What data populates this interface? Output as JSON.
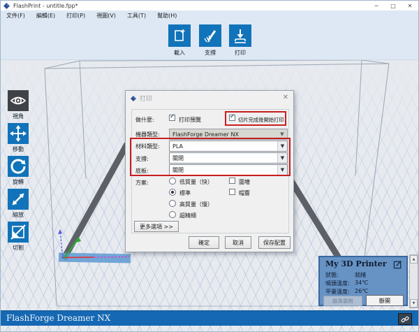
{
  "window": {
    "title": "FlashPrint - untitle.fpp*",
    "minimize": "─",
    "maximize": "□",
    "close": "✕"
  },
  "menu": {
    "items": [
      "文件(F)",
      "編輯(E)",
      "打印(P)",
      "視圖(V)",
      "工具(T)",
      "幫助(H)"
    ]
  },
  "toolbar": {
    "buttons": [
      {
        "label": "載入",
        "icon": "load-icon"
      },
      {
        "label": "支撐",
        "icon": "support-icon"
      },
      {
        "label": "打印",
        "icon": "print-icon"
      }
    ]
  },
  "sidebar": {
    "tools": [
      {
        "label": "視角",
        "icon": "eye-icon",
        "active": true
      },
      {
        "label": "移動",
        "icon": "move-icon",
        "active": false
      },
      {
        "label": "旋轉",
        "icon": "rotate-icon",
        "active": false
      },
      {
        "label": "縮放",
        "icon": "scale-icon",
        "active": false
      },
      {
        "label": "切割",
        "icon": "cut-icon",
        "active": false
      }
    ]
  },
  "dialog": {
    "title": "打印",
    "close": "✕",
    "what_label": "做什麼:",
    "print_preview": {
      "label": "打印預覽",
      "checked": true
    },
    "start_after_slicing": {
      "label": "切片完成後開始打印",
      "checked": true,
      "highlighted": true
    },
    "machine_type": {
      "label": "機器類型:",
      "value": "FlashForge Dreamer NX",
      "disabled": true
    },
    "material_type": {
      "label": "材料類型:",
      "value": "PLA"
    },
    "support": {
      "label": "支撐:",
      "value": "關閉"
    },
    "raft": {
      "label": "底板:",
      "value": "關閉"
    },
    "scheme": {
      "label": "方案:",
      "options": [
        {
          "label": "低質量（快）",
          "selected": false
        },
        {
          "label": "標準",
          "selected": true
        },
        {
          "label": "高質量（慢）",
          "selected": false
        },
        {
          "label": "超精細",
          "selected": false
        }
      ]
    },
    "wall": {
      "label": "圍墻",
      "checked": false
    },
    "brim": {
      "label": "帽簷",
      "checked": false
    },
    "more_options_label": "更多選項 >>",
    "buttons": {
      "ok": "確定",
      "cancel": "取消",
      "save_config": "保存配置"
    }
  },
  "printer_panel": {
    "title": "My 3D Printer",
    "status_label": "狀態:",
    "status_value": "就緒",
    "nozzle_temp_label": "噴頭溫度:",
    "nozzle_temp_value": "34℃",
    "platform_temp_label": "平臺溫度:",
    "platform_temp_value": "26℃",
    "set_current_label": "設為當前",
    "disconnect_label": "斷開"
  },
  "statusbar": {
    "machine_name": "FlashForge Dreamer NX"
  },
  "colors": {
    "accent_blue": "#1173b9",
    "statusbar_blue": "#1568b3",
    "panel_blue": "#6792c4",
    "highlight_red": "#c81e1e",
    "active_tool_dark": "#3f4247"
  },
  "checkmark_glyph": "✓",
  "scroll": {
    "up": "▲",
    "down": "▼"
  },
  "combo_arrow": "▼"
}
